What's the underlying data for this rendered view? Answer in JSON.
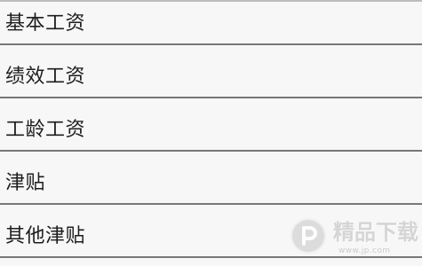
{
  "form": {
    "fields": [
      {
        "label": "基本工资",
        "value": ""
      },
      {
        "label": "绩效工资",
        "value": ""
      },
      {
        "label": "工龄工资",
        "value": ""
      },
      {
        "label": "津贴",
        "value": ""
      },
      {
        "label": "其他津贴",
        "value": ""
      }
    ]
  },
  "watermark": {
    "text": "精品下载",
    "url": "www.jp.com",
    "icon": "brand-p-icon"
  },
  "colors": {
    "background": "#f7f7f7",
    "text": "#1d1d1d",
    "underline": "#777777",
    "top_rule": "#bdbdbd",
    "watermark": "#d0d0d0"
  }
}
